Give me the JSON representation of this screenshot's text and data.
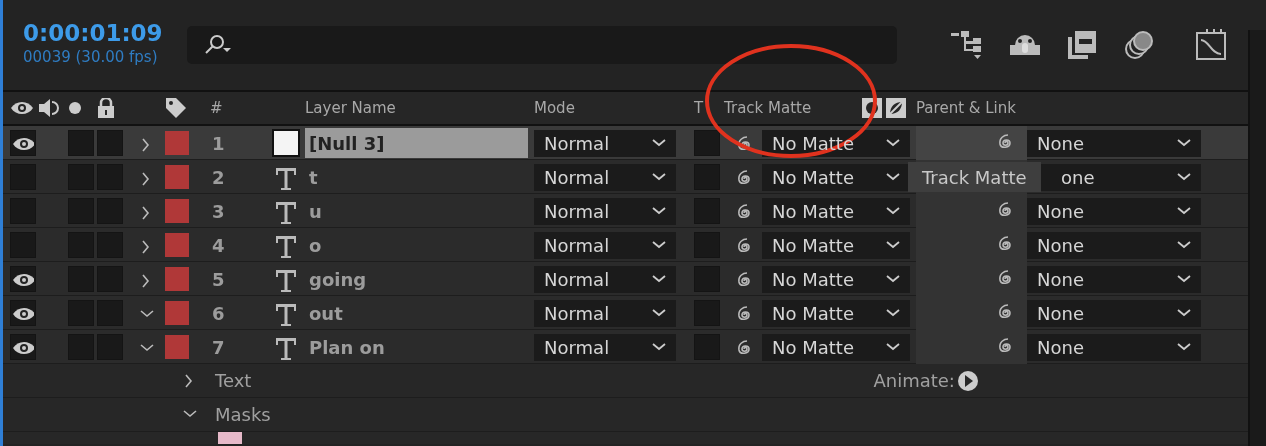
{
  "timecode": "0:00:01:09",
  "frame_info": "00039 (30.00 fps)",
  "columns": {
    "number": "#",
    "layer_name": "Layer Name",
    "mode": "Mode",
    "preserve": "T",
    "track_matte": "Track Matte",
    "parent": "Parent & Link"
  },
  "layers": [
    {
      "number": "1",
      "name": "[Null 3]",
      "kind": "null",
      "visible": true,
      "expanded": false,
      "selected": true,
      "color": "#b03838",
      "mode": "Normal",
      "track_matte": "No Matte",
      "parent": "None"
    },
    {
      "number": "2",
      "name": "t",
      "kind": "text",
      "visible": false,
      "expanded": false,
      "selected": false,
      "color": "#b03838",
      "mode": "Normal",
      "track_matte": "No Matte",
      "parent": "one",
      "tooltip": "Track Matte"
    },
    {
      "number": "3",
      "name": "u",
      "kind": "text",
      "visible": false,
      "expanded": false,
      "selected": false,
      "color": "#b03838",
      "mode": "Normal",
      "track_matte": "No Matte",
      "parent": "None"
    },
    {
      "number": "4",
      "name": "o",
      "kind": "text",
      "visible": false,
      "expanded": false,
      "selected": false,
      "color": "#b03838",
      "mode": "Normal",
      "track_matte": "No Matte",
      "parent": "None"
    },
    {
      "number": "5",
      "name": "going",
      "kind": "text",
      "visible": true,
      "expanded": false,
      "selected": false,
      "color": "#b03838",
      "mode": "Normal",
      "track_matte": "No Matte",
      "parent": "None"
    },
    {
      "number": "6",
      "name": "out",
      "kind": "text",
      "visible": true,
      "expanded": true,
      "selected": false,
      "color": "#b03838",
      "mode": "Normal",
      "track_matte": "No Matte",
      "parent": "None"
    },
    {
      "number": "7",
      "name": "Plan on",
      "kind": "text",
      "visible": true,
      "expanded": true,
      "selected": false,
      "color": "#b03838",
      "mode": "Normal",
      "track_matte": "No Matte",
      "parent": "None"
    }
  ],
  "properties": [
    {
      "label": "Text",
      "expanded": false,
      "action": "Animate:"
    },
    {
      "label": "Masks",
      "expanded": true
    }
  ]
}
